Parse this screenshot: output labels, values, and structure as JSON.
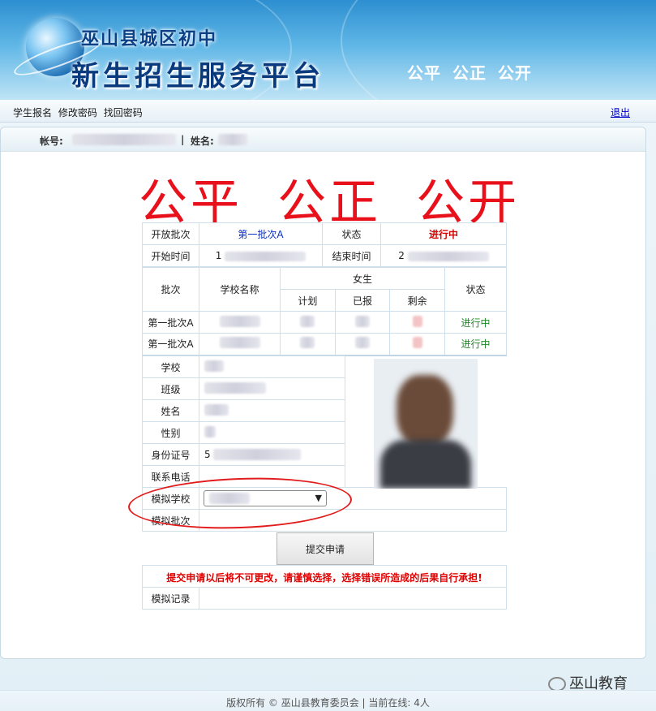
{
  "banner": {
    "title_line1": "巫山县城区初中",
    "title_line2": "新生招生服务平台",
    "slogan": "公平 公正 公开"
  },
  "nav": {
    "links": [
      "学生报名",
      "修改密码",
      "找回密码"
    ],
    "logout": "退出"
  },
  "userbar": {
    "account_label": "帐号:",
    "separator": "|",
    "name_label": "姓名:"
  },
  "big_slogan": "公平  公正  公开",
  "batch_info": {
    "open_batch_label": "开放批次",
    "open_batch_value": "第一批次A",
    "status_label": "状态",
    "status_value": "进行中",
    "start_label": "开始时间",
    "start_value_prefix": "1",
    "end_label": "结束时间",
    "end_value_prefix": "2"
  },
  "quota_table": {
    "headers": {
      "batch": "批次",
      "school": "学校名称",
      "group": "女生",
      "plan": "计划",
      "reported": "已报",
      "remaining": "剩余",
      "status": "状态"
    },
    "rows": [
      {
        "batch": "第一批次A",
        "status": "进行中"
      },
      {
        "batch": "第一批次A",
        "status": "进行中"
      }
    ]
  },
  "form": {
    "school": "学校",
    "class": "班级",
    "name": "姓名",
    "gender": "性别",
    "id_number": "身份证号",
    "id_prefix": "5",
    "phone": "联系电话",
    "mock_school": "模拟学校",
    "mock_batch": "模拟批次",
    "submit": "提交申请",
    "warning": "提交申请以后将不可更改，请谨慎选择，选择错误所造成的后果自行承担!",
    "mock_record": "模拟记录"
  },
  "footer": {
    "text": "版权所有 © 巫山县教育委员会 | 当前在线: 4人"
  },
  "watermark": "巫山教育",
  "colors": {
    "accent_red": "#e8111b",
    "link_blue": "#0000cc",
    "status_green": "#1c8a24"
  }
}
